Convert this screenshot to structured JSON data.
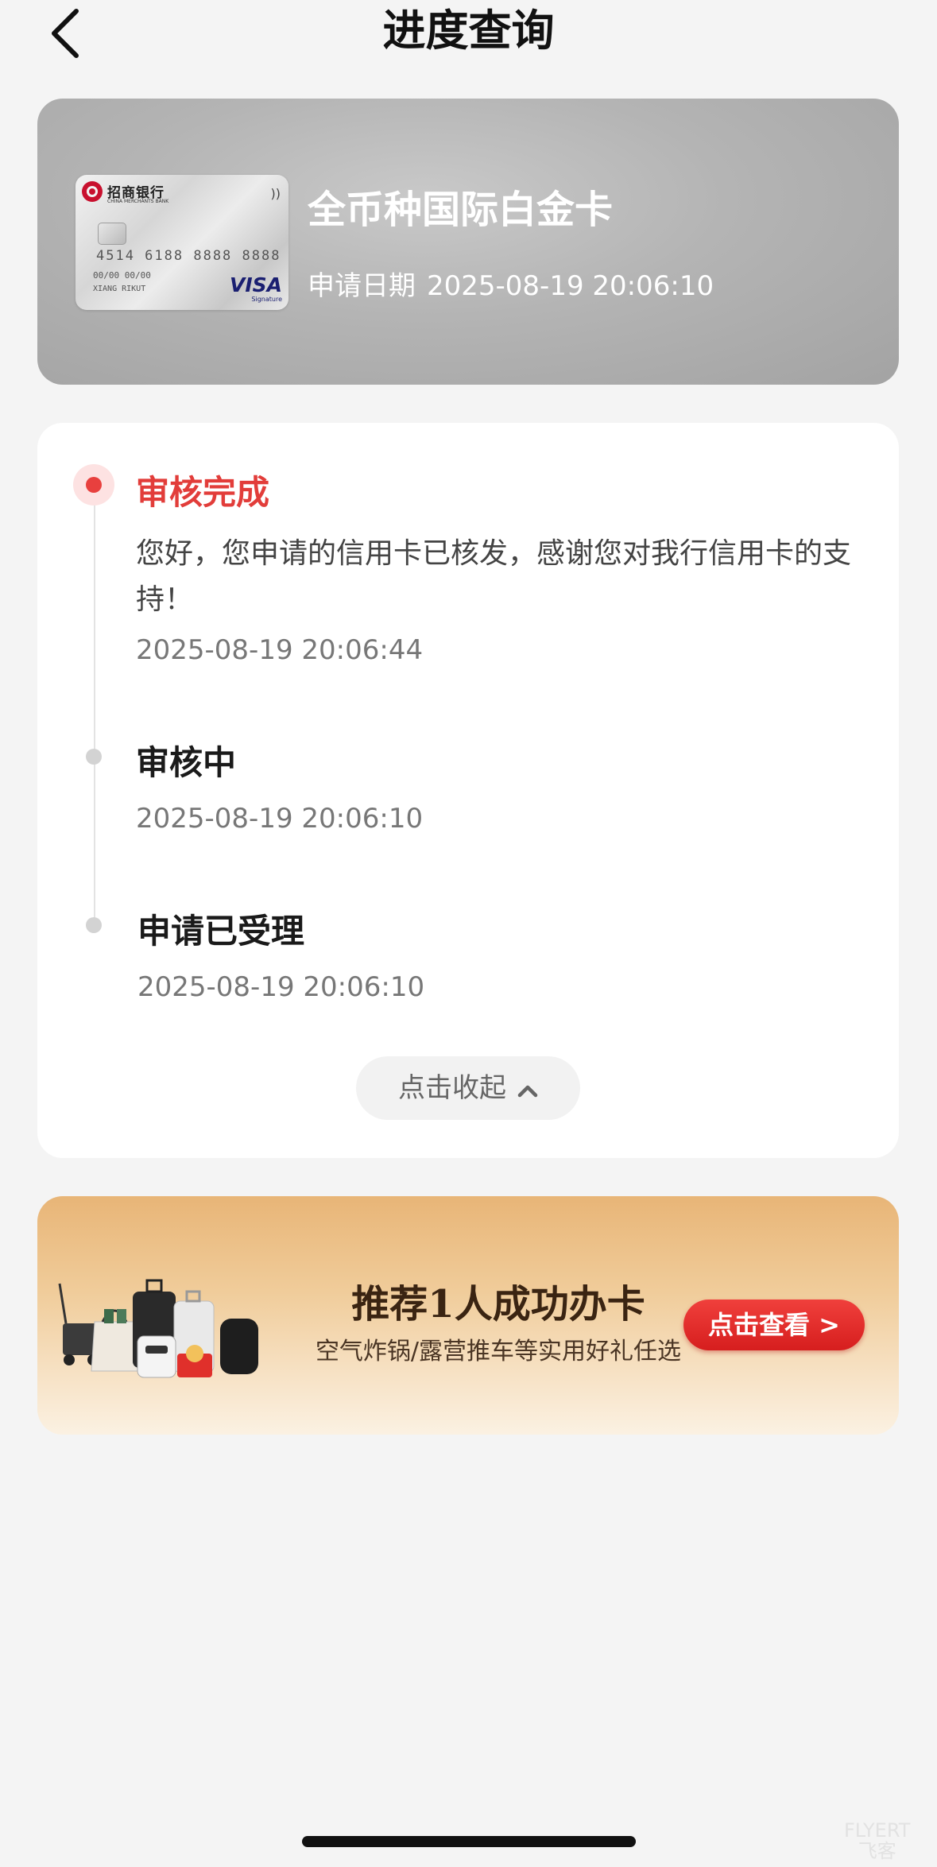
{
  "header": {
    "title": "进度查询"
  },
  "card": {
    "name": "全币种国际白金卡",
    "apply_date_label": "申请日期",
    "apply_date_value": "2025-08-19 20:06:10",
    "image": {
      "bank_name": "招商银行",
      "bank_name_en": "CHINA MERCHANTS BANK",
      "number": "4514 6188 8888 8888",
      "expiry": "00/00 00/00",
      "holder": "XIANG RIKUT",
      "network": "VISA",
      "network_sub": "Signature"
    }
  },
  "timeline": {
    "steps": [
      {
        "title": "审核完成",
        "desc": "您好，您申请的信用卡已核发，感谢您对我行信用卡的支持！",
        "time": "2025-08-19 20:06:44",
        "active": true
      },
      {
        "title": "审核中",
        "time": "2025-08-19 20:06:10",
        "active": false
      },
      {
        "title": "申请已受理",
        "time": "2025-08-19 20:06:10",
        "active": false
      }
    ],
    "collapse_label": "点击收起"
  },
  "promo": {
    "title": "推荐1人成功办卡",
    "subtitle": "空气炸锅/露营推车等实用好礼任选",
    "cta_label": "点击查看 >"
  },
  "watermark": {
    "line1": "FLYERT",
    "line2": "飞客"
  },
  "colors": {
    "accent_red": "#e23d3a",
    "background": "#f4f4f4",
    "promo_gold": "#e8b577"
  },
  "icons": {
    "back": "chevron-left-icon",
    "collapse": "chevron-up-icon"
  }
}
